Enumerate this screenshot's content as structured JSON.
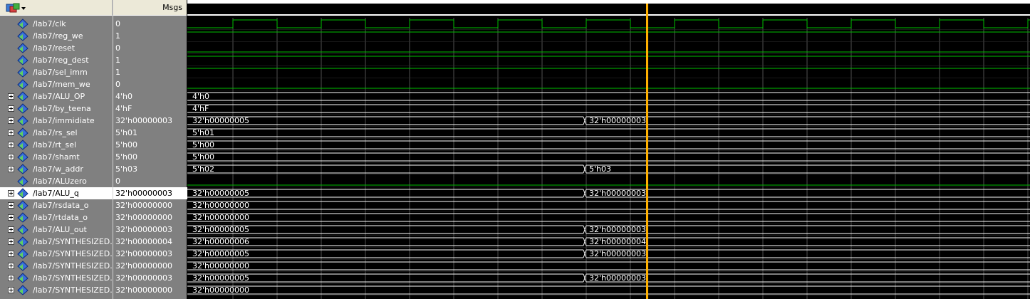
{
  "header": {
    "names_icon": "waveform-tool-icon",
    "values_title": "Msgs"
  },
  "colors": {
    "panel_bg": "#808080",
    "wave_green": "#00c000",
    "cursor": "#ffb000",
    "grid": "#505050"
  },
  "signals": [
    {
      "name": "/lab7/clk",
      "value": "0",
      "bus": false,
      "kind": "clock"
    },
    {
      "name": "/lab7/reg_we",
      "value": "1",
      "bus": false,
      "kind": "high"
    },
    {
      "name": "/lab7/reset",
      "value": "0",
      "bus": false,
      "kind": "low"
    },
    {
      "name": "/lab7/reg_dest",
      "value": "1",
      "bus": false,
      "kind": "high"
    },
    {
      "name": "/lab7/sel_imm",
      "value": "1",
      "bus": false,
      "kind": "high"
    },
    {
      "name": "/lab7/mem_we",
      "value": "0",
      "bus": false,
      "kind": "low"
    },
    {
      "name": "/lab7/ALU_OP",
      "value": "4'h0",
      "bus": true,
      "segments": [
        "4'h0"
      ]
    },
    {
      "name": "/lab7/by_teena",
      "value": "4'hF",
      "bus": true,
      "segments": [
        "4'hF"
      ]
    },
    {
      "name": "/lab7/immidiate",
      "value": "32'h00000003",
      "bus": true,
      "segments": [
        "32'h00000005",
        "32'h00000003"
      ]
    },
    {
      "name": "/lab7/rs_sel",
      "value": "5'h01",
      "bus": true,
      "segments": [
        "5'h01"
      ]
    },
    {
      "name": "/lab7/rt_sel",
      "value": "5'h00",
      "bus": true,
      "segments": [
        "5'h00"
      ]
    },
    {
      "name": "/lab7/shamt",
      "value": "5'h00",
      "bus": true,
      "segments": [
        "5'h00"
      ]
    },
    {
      "name": "/lab7/w_addr",
      "value": "5'h03",
      "bus": true,
      "segments": [
        "5'h02",
        "5'h03"
      ]
    },
    {
      "name": "/lab7/ALUzero",
      "value": "0",
      "bus": false,
      "kind": "low"
    },
    {
      "name": "/lab7/ALU_q",
      "value": "32'h00000003",
      "bus": true,
      "selected": true,
      "segments": [
        "32'h00000005",
        "32'h00000003"
      ]
    },
    {
      "name": "/lab7/rsdata_o",
      "value": "32'h00000000",
      "bus": true,
      "segments": [
        "32'h00000000"
      ]
    },
    {
      "name": "/lab7/rtdata_o",
      "value": "32'h00000000",
      "bus": true,
      "segments": [
        "32'h00000000"
      ]
    },
    {
      "name": "/lab7/ALU_out",
      "value": "32'h00000003",
      "bus": true,
      "segments": [
        "32'h00000005",
        "32'h00000003"
      ]
    },
    {
      "name": "/lab7/SYNTHESIZED...",
      "value": "32'h00000004",
      "bus": true,
      "segments": [
        "32'h00000006",
        "32'h00000004"
      ]
    },
    {
      "name": "/lab7/SYNTHESIZED...",
      "value": "32'h00000003",
      "bus": true,
      "segments": [
        "32'h00000005",
        "32'h00000003"
      ]
    },
    {
      "name": "/lab7/SYNTHESIZED...",
      "value": "32'h00000000",
      "bus": true,
      "segments": [
        "32'h00000000"
      ]
    },
    {
      "name": "/lab7/SYNTHESIZED...",
      "value": "32'h00000003",
      "bus": true,
      "segments": [
        "32'h00000005",
        "32'h00000003"
      ]
    },
    {
      "name": "/lab7/SYNTHESIZED...",
      "value": "32'h00000000",
      "bus": true,
      "segments": [
        "32'h00000000"
      ]
    }
  ]
}
